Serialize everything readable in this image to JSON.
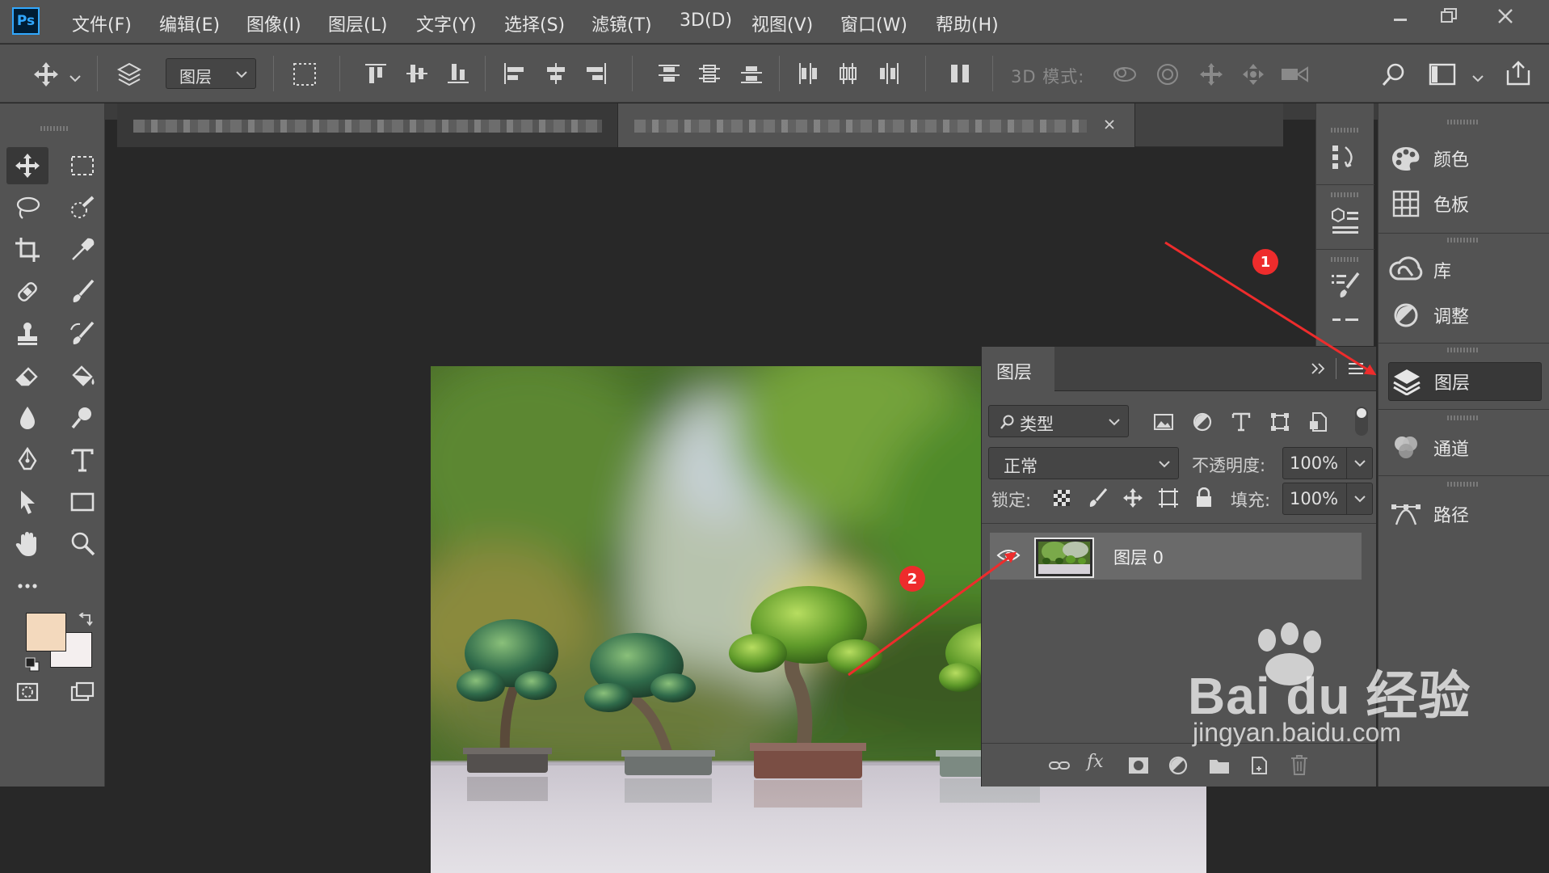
{
  "app": {
    "logo": "Ps",
    "menu": [
      "文件(F)",
      "编辑(E)",
      "图像(I)",
      "图层(L)",
      "文字(Y)",
      "选择(S)",
      "滤镜(T)",
      "3D(D)",
      "视图(V)",
      "窗口(W)",
      "帮助(H)"
    ],
    "window_controls": [
      "minimize-icon",
      "restore-icon",
      "close-icon"
    ]
  },
  "options_bar": {
    "layer_select": "图层",
    "mode_3d_label": "3D 模式:"
  },
  "right_dock": {
    "items": [
      {
        "label": "颜色",
        "icon": "palette-icon"
      },
      {
        "label": "色板",
        "icon": "swatches-grid-icon"
      },
      {
        "label": "库",
        "icon": "creative-cloud-icon"
      },
      {
        "label": "调整",
        "icon": "adjustments-icon"
      },
      {
        "label": "图层",
        "icon": "layers-icon",
        "selected": true
      },
      {
        "label": "通道",
        "icon": "channels-icon"
      },
      {
        "label": "路径",
        "icon": "paths-icon"
      }
    ]
  },
  "layers_panel": {
    "title": "图层",
    "filter_dropdown": "类型",
    "blend_mode": "正常",
    "opacity_label": "不透明度:",
    "opacity_value": "100%",
    "lock_label": "锁定:",
    "fill_label": "填充:",
    "fill_value": "100%",
    "layers": [
      {
        "name": "图层 0",
        "visible": true
      }
    ]
  },
  "tools": {
    "foreground_color": "#f3d9bd",
    "background_color": "#f4efef"
  },
  "annotations": {
    "badge_1": "1",
    "badge_2": "2",
    "arrow_color": "#ee2c2c"
  },
  "watermark": {
    "brand": "Bai du 经验",
    "url": "jingyan.baidu.com"
  }
}
